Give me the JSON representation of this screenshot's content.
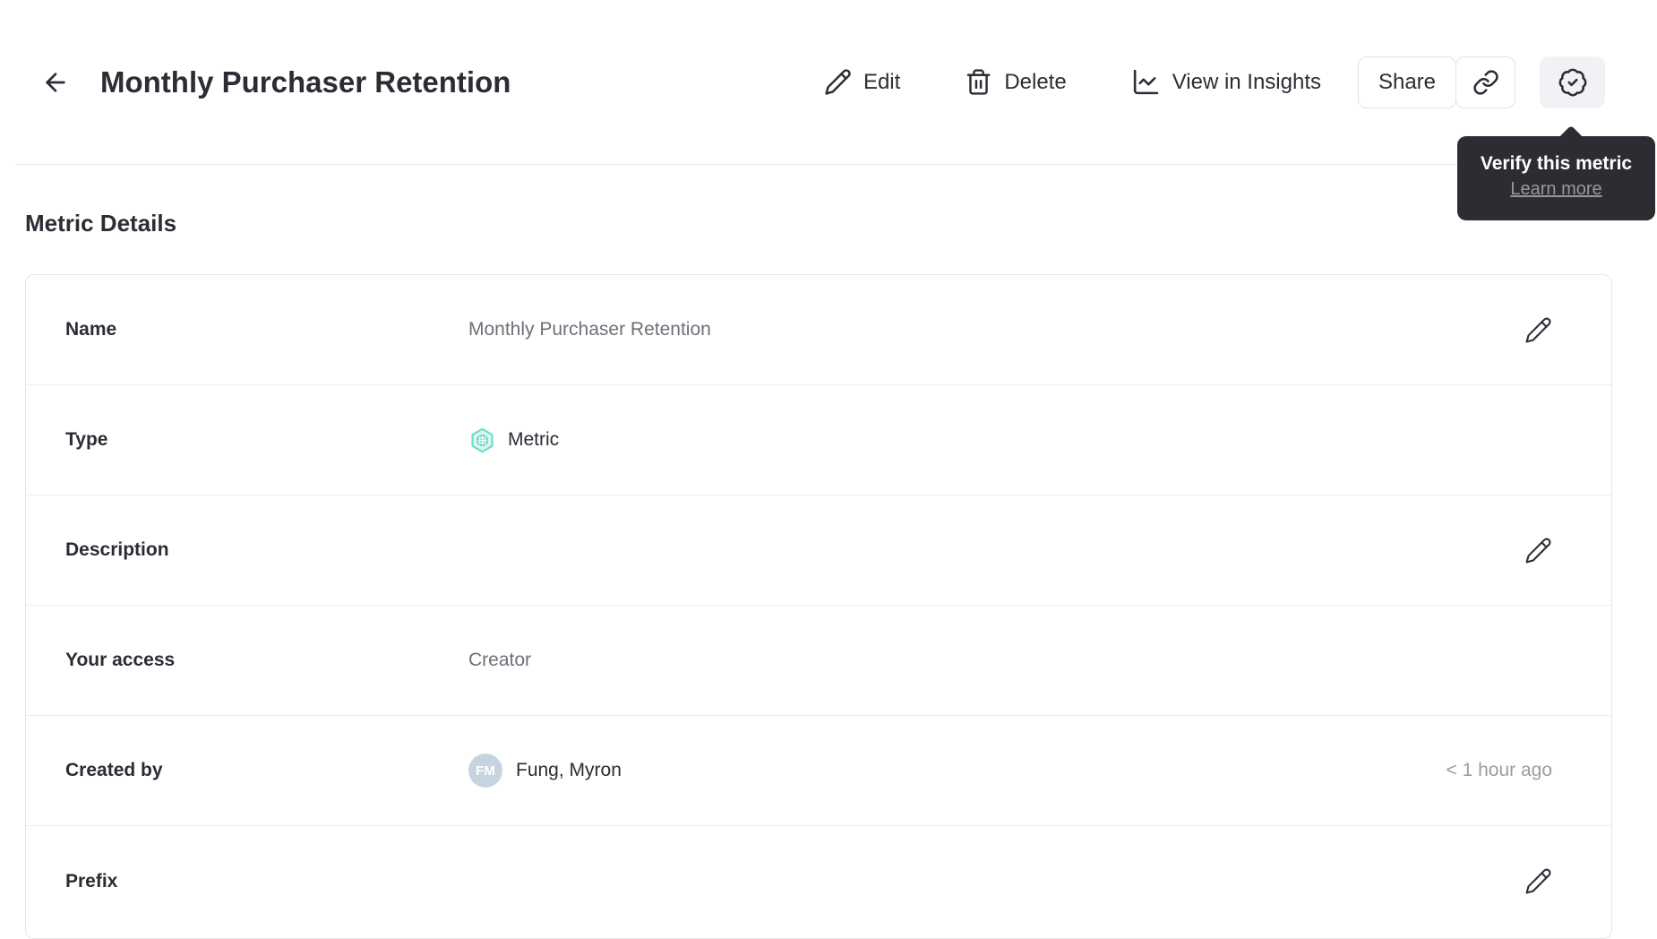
{
  "header": {
    "title": "Monthly Purchaser Retention",
    "actions": {
      "edit_label": "Edit",
      "delete_label": "Delete",
      "insights_label": "View in Insights",
      "share_label": "Share"
    }
  },
  "tooltip": {
    "title": "Verify this metric",
    "link_label": "Learn more"
  },
  "section": {
    "title": "Metric Details"
  },
  "details": {
    "rows": [
      {
        "label": "Name",
        "value": "Monthly Purchaser Retention"
      },
      {
        "label": "Type",
        "value": "Metric"
      },
      {
        "label": "Description",
        "value": ""
      },
      {
        "label": "Your access",
        "value": "Creator"
      },
      {
        "label": "Created by",
        "value": "Fung, Myron",
        "avatar_initials": "FM",
        "meta": "< 1 hour ago"
      },
      {
        "label": "Prefix",
        "value": ""
      }
    ]
  },
  "icons": {
    "back": "arrow-left-icon",
    "edit": "pencil-icon",
    "delete": "trash-icon",
    "insights": "line-chart-icon",
    "link": "link-icon",
    "verify": "verified-badge-icon",
    "metric_type": "teal-hexagon-icon"
  },
  "colors": {
    "ink": "#2b2d35",
    "value_gray": "#6f6f79",
    "meta_gray": "#9c9ca3",
    "divider": "#ededf0",
    "card_border": "#e5e5e9",
    "button_border": "#e2e2e6",
    "verify_button_bg": "#f2f2f6",
    "tooltip_bg": "#2c2d33",
    "tooltip_link": "#97979e",
    "hexagon_stroke": "#6fdccb",
    "hexagon_fill": "#dcf6f0",
    "avatar_bg": "#c7d3e1"
  }
}
